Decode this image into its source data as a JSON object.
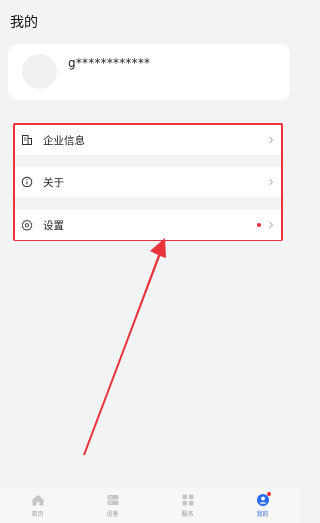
{
  "page": {
    "title": "我的"
  },
  "profile": {
    "username": "g************"
  },
  "menu": {
    "items": [
      {
        "label": "企业信息",
        "icon": "building-icon"
      },
      {
        "label": "关于",
        "icon": "info-icon"
      },
      {
        "label": "设置",
        "icon": "gear-icon",
        "has_dot": true
      }
    ]
  },
  "tabbar": {
    "tabs": [
      {
        "label": "首页",
        "icon": "home-icon"
      },
      {
        "label": "设备",
        "icon": "device-icon"
      },
      {
        "label": "服务",
        "icon": "grid-icon"
      },
      {
        "label": "我的",
        "icon": "user-icon",
        "active": true
      }
    ]
  },
  "colors": {
    "accent": "#2b6cf0",
    "highlight_red": "#e8343a",
    "background": "#f2f3f5"
  }
}
